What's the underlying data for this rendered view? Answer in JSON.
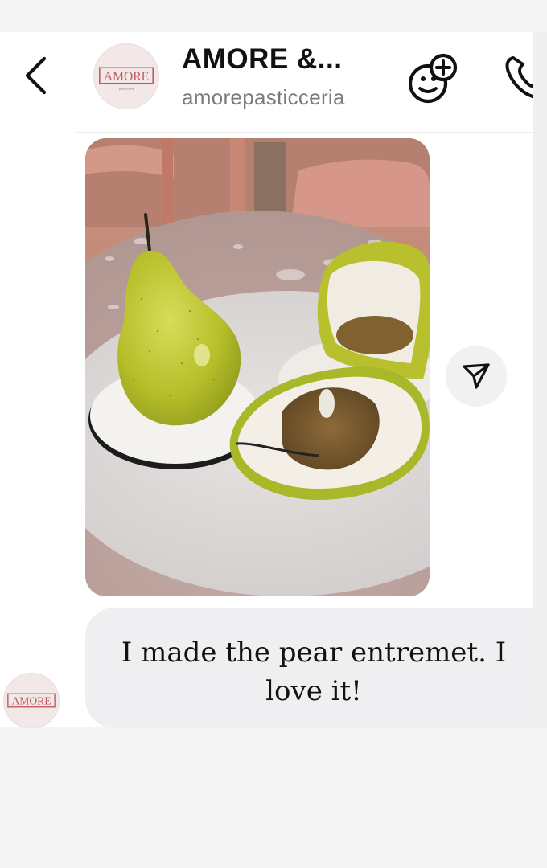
{
  "header": {
    "title": "AMORE &...",
    "subtitle": "amorepasticceria",
    "avatar_logo": "AMORE",
    "back_icon": "chevron-left-icon",
    "effects_icon": "face-sticker-add-icon",
    "call_icon": "phone-icon"
  },
  "message": {
    "photo_description": "photo",
    "text": "I made the pear entremet.  I love it!",
    "share_icon": "send-icon",
    "sender_avatar_logo": "AMORE"
  },
  "colors": {
    "background": "#ffffff",
    "bubble": "#efeff1",
    "subtitle": "#7a7a7a",
    "logo": "#c05860"
  }
}
